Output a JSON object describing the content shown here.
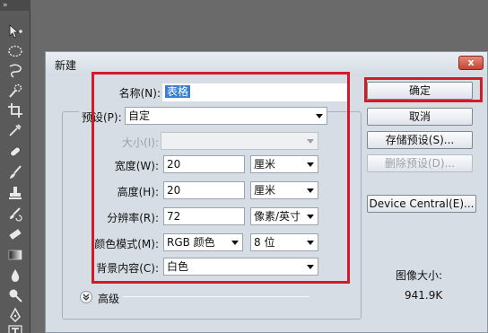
{
  "toolbar": {
    "grip": "»",
    "tools": [
      "move-tool-icon",
      "marquee-tool-icon",
      "lasso-tool-icon",
      "quick-selection-tool-icon",
      "crop-tool-icon",
      "eyedropper-tool-icon",
      "healing-brush-tool-icon",
      "brush-tool-icon",
      "clone-stamp-tool-icon",
      "history-brush-tool-icon",
      "eraser-tool-icon",
      "gradient-tool-icon",
      "blur-tool-icon",
      "dodge-tool-icon",
      "pen-tool-icon",
      "type-tool-icon"
    ]
  },
  "dialog": {
    "title": "新建",
    "close_label": "x",
    "name": {
      "label": "名称(N):",
      "value": "表格"
    },
    "preset": {
      "label": "预设(P):",
      "value": "自定"
    },
    "size": {
      "label": "大小(I):",
      "value": ""
    },
    "width": {
      "label": "宽度(W):",
      "value": "20",
      "unit": "厘米"
    },
    "height": {
      "label": "高度(H):",
      "value": "20",
      "unit": "厘米"
    },
    "resolution": {
      "label": "分辨率(R):",
      "value": "72",
      "unit": "像素/英寸"
    },
    "color_mode": {
      "label": "颜色模式(M):",
      "value": "RGB 颜色",
      "depth": "8 位"
    },
    "background": {
      "label": "背景内容(C):",
      "value": "白色"
    },
    "advanced_label": "高级",
    "buttons": {
      "ok": "确定",
      "cancel": "取消",
      "save_preset": "存储预设(S)...",
      "delete_preset": "删除预设(D)...",
      "device_central": "Device Central(E)..."
    },
    "image_size": {
      "label": "图像大小:",
      "value": "941.9K"
    }
  },
  "colors": {
    "highlight": "#d11a2a",
    "selection": "#3a7ecf"
  }
}
